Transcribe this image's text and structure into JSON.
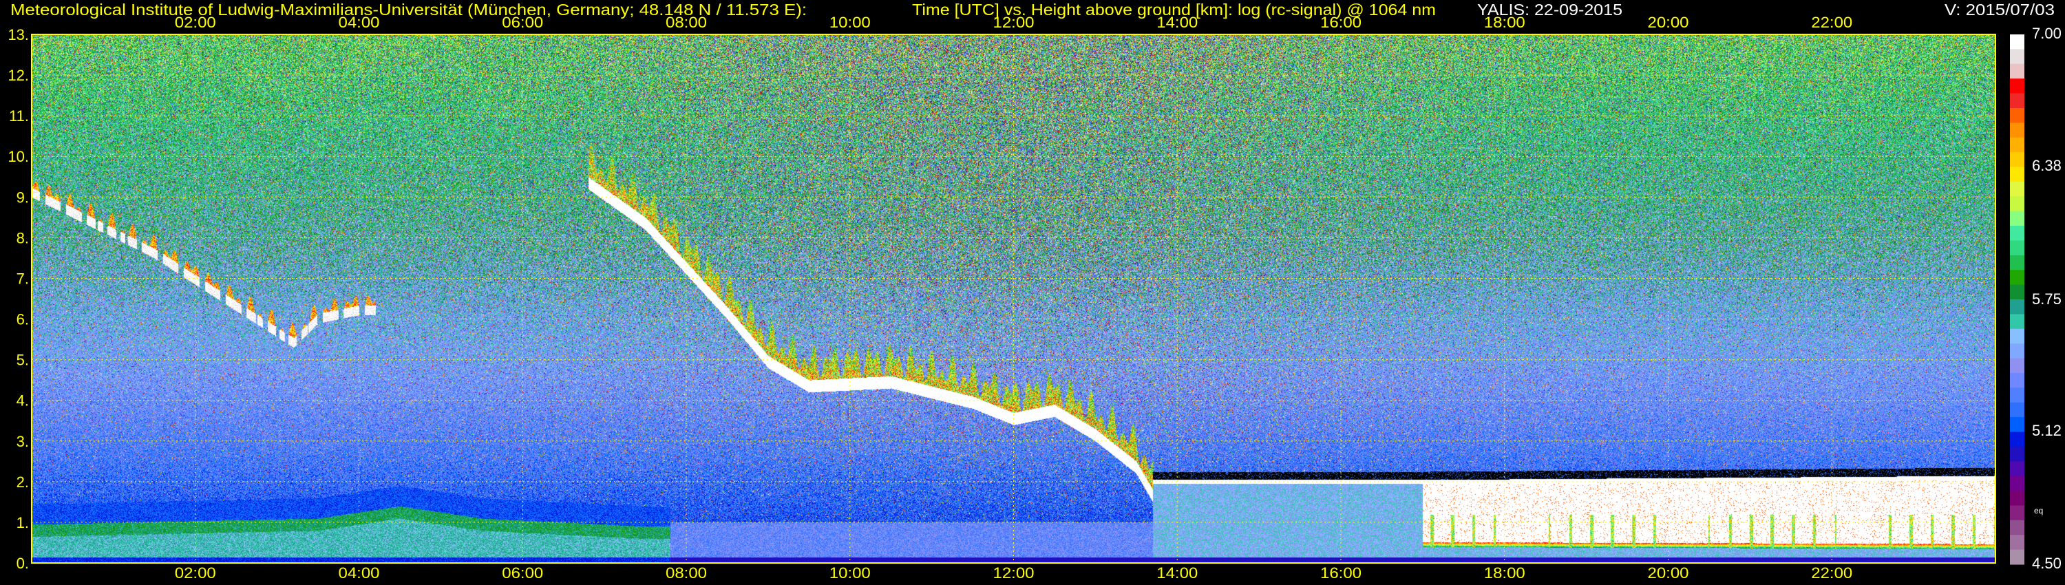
{
  "header": {
    "institute": "Meteorological Institute of Ludwig-Maximilians-Universität (München, Germany; 48.148 N / 11.573 E):",
    "description": "Time [UTC] vs. Height above ground [km]: log (rc-signal) @ 1064 nm",
    "instrument_date": "YALIS: 22-09-2015",
    "version": "V: 2015/07/03"
  },
  "colors": {
    "text_yellow": "#ffff00",
    "text_white": "#ffffff",
    "grid": "#ffff00",
    "background": "#000000"
  },
  "chart_data": {
    "type": "heatmap",
    "title": "Time [UTC] vs. Height above ground [km]: log (rc-signal) @ 1064 nm",
    "xlabel": "Time [UTC]",
    "ylabel": "Height above ground [km]",
    "xlim_hours": [
      0,
      24
    ],
    "ylim": [
      0,
      13
    ],
    "x_ticks": [
      "02:00",
      "04:00",
      "06:00",
      "08:00",
      "10:00",
      "12:00",
      "14:00",
      "16:00",
      "18:00",
      "20:00",
      "22:00"
    ],
    "y_ticks": [
      "0.",
      "1.",
      "2.",
      "3.",
      "4.",
      "5.",
      "6.",
      "7.",
      "8.",
      "9.",
      "10.",
      "11.",
      "12.",
      "13."
    ],
    "grid": true,
    "colorbar": {
      "range": [
        4.5,
        7.0
      ],
      "tick_labels": [
        "7.00",
        "6.38",
        "5.75",
        "5.12",
        "4.50"
      ],
      "note": "eq",
      "colors_top_to_bottom": [
        "#ffffff",
        "#e8dfe0",
        "#ecc3c4",
        "#ff0000",
        "#f02828",
        "#ff6000",
        "#ff9000",
        "#ffb000",
        "#ffcc00",
        "#ffe800",
        "#e0f840",
        "#c8f840",
        "#88ff80",
        "#40e8a0",
        "#30d880",
        "#20c050",
        "#20a800",
        "#109030",
        "#20a090",
        "#30c8a8",
        "#88c0ff",
        "#80a8ff",
        "#9090f0",
        "#7088ff",
        "#5080ff",
        "#3070ff",
        "#0060ff",
        "#0018e0",
        "#2010c0",
        "#5008b0",
        "#700090",
        "#780070",
        "#882080",
        "#905090",
        "#a070a0",
        "#a890a8"
      ]
    },
    "features": {
      "boundary_layer_top_km": {
        "hours": [
          0,
          3.5,
          4.5,
          5.5,
          7.5
        ],
        "km": [
          0.95,
          1.1,
          1.4,
          1.1,
          0.9
        ]
      },
      "morning_cirrus_base_km": {
        "hours": [
          0,
          0.5,
          1.5,
          2.5,
          3.2,
          3.5,
          4.0
        ],
        "km": [
          9.0,
          8.5,
          7.5,
          6.2,
          5.3,
          5.9,
          6.1
        ]
      },
      "descending_cloud_base_km": {
        "hours": [
          6.8,
          7.5,
          8.5,
          9.0,
          9.5,
          10.5,
          11.5,
          12.0,
          12.5,
          13.0,
          13.5,
          13.7
        ],
        "km": [
          9.2,
          8.2,
          6.0,
          4.8,
          4.2,
          4.3,
          3.8,
          3.4,
          3.6,
          3.0,
          2.2,
          1.5
        ]
      },
      "low_cloud_top_km": {
        "hours": [
          13.7,
          17.0,
          24.0
        ],
        "km": [
          2.0,
          2.0,
          2.1
        ]
      },
      "low_cloud_base_km": {
        "hours": [
          17.0,
          24.0
        ],
        "km": [
          0.4,
          0.35
        ]
      }
    }
  }
}
